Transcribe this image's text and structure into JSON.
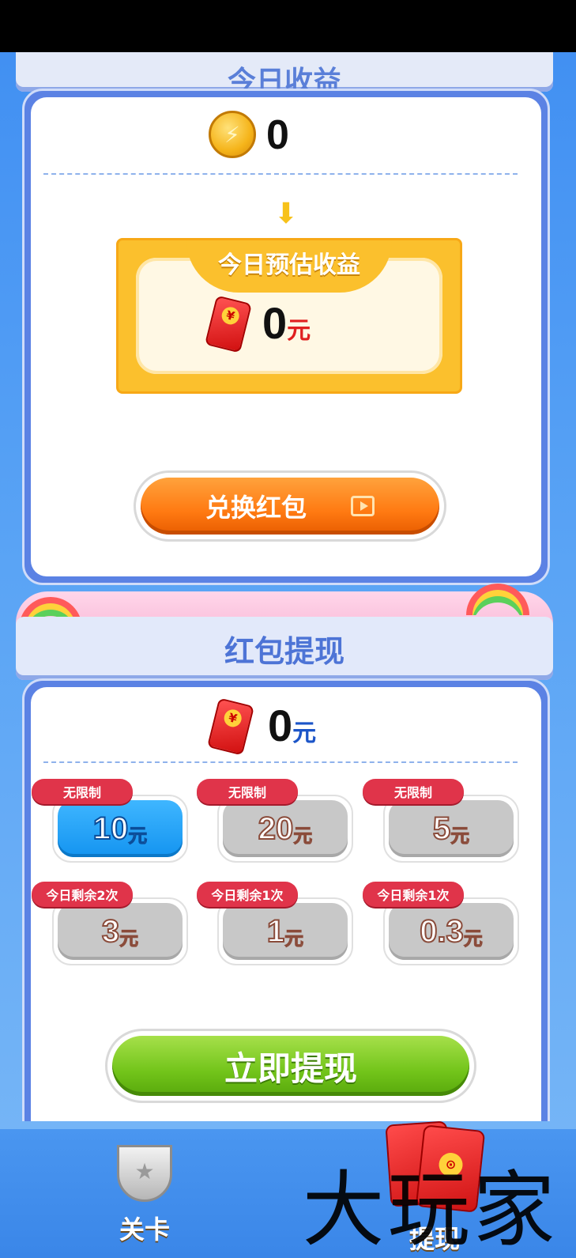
{
  "header": {
    "title": "今日收益"
  },
  "coins": {
    "amount": "0"
  },
  "estimate": {
    "title": "今日预估收益",
    "amount": "0",
    "unit": "元"
  },
  "exchange_button": {
    "label": "兑换红包",
    "icon": "video-icon"
  },
  "withdraw_section": {
    "title": "红包提现",
    "balance": "0",
    "unit": "元",
    "options": [
      {
        "value": "10",
        "unit": "元",
        "tag": "无限制",
        "selected": true
      },
      {
        "value": "20",
        "unit": "元",
        "tag": "无限制",
        "selected": false
      },
      {
        "value": "5",
        "unit": "元",
        "tag": "无限制",
        "selected": false
      },
      {
        "value": "3",
        "unit": "元",
        "tag": "今日剩余2次",
        "selected": false
      },
      {
        "value": "1",
        "unit": "元",
        "tag": "今日剩余1次",
        "selected": false
      },
      {
        "value": "0.3",
        "unit": "元",
        "tag": "今日剩余1次",
        "selected": false
      }
    ],
    "submit_label": "立即提现"
  },
  "nav": {
    "items": [
      {
        "label": "关卡",
        "icon": "trophy-icon"
      },
      {
        "label": "提现",
        "icon": "red-envelope-icon",
        "active": true
      }
    ]
  },
  "watermark": {
    "text": "大玩家"
  },
  "colors": {
    "background": "#4a96f0",
    "selected_option": "#1494f0",
    "exchange_button": "#ff7a12",
    "submit_button": "#72c41a",
    "tag": "#e0344a"
  }
}
